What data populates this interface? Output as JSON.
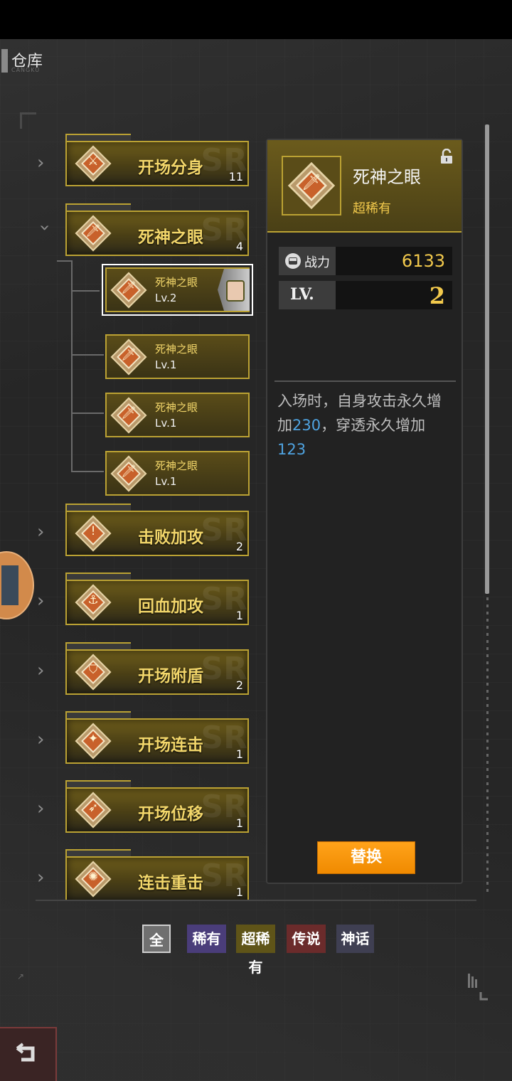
{
  "page": {
    "title": "仓库",
    "title_sub": "CANGKU"
  },
  "items": [
    {
      "name": "开场分身",
      "count": "11",
      "glyph": "⚔"
    },
    {
      "name": "死神之眼",
      "count": "4",
      "glyph": "🗡"
    },
    {
      "name": "击败加攻",
      "count": "2",
      "glyph": "!"
    },
    {
      "name": "回血加攻",
      "count": "1",
      "glyph": "⚓"
    },
    {
      "name": "开场附盾",
      "count": "2",
      "glyph": "⛉"
    },
    {
      "name": "开场连击",
      "count": "1",
      "glyph": "✦"
    },
    {
      "name": "开场位移",
      "count": "1",
      "glyph": "➶"
    },
    {
      "name": "连击重击",
      "count": "1",
      "glyph": "✺"
    }
  ],
  "subitems": [
    {
      "name": "死神之眼",
      "level": "Lv.2"
    },
    {
      "name": "死神之眼",
      "level": "Lv.1"
    },
    {
      "name": "死神之眼",
      "level": "Lv.1"
    },
    {
      "name": "死神之眼",
      "level": "Lv.1"
    }
  ],
  "detail": {
    "name": "死神之眼",
    "rarity": "超稀有",
    "power_label": "战力",
    "power_value": "6133",
    "lv_label": "LV.",
    "lv_value": "2",
    "desc_part1": "入场时，自身攻击永久增加",
    "desc_num1": "230",
    "desc_part2": "，穿透永久增加",
    "desc_num2": "123",
    "replace_label": "替换"
  },
  "filters": {
    "all": "全",
    "rare": "稀有",
    "super_rare": "超稀有",
    "legendary": "传说",
    "mythic": "神话"
  },
  "colors": {
    "accent": "#bba233",
    "gold_text": "#f2d66a",
    "button": "#ffa31a",
    "link_number": "#4fa3e0"
  }
}
